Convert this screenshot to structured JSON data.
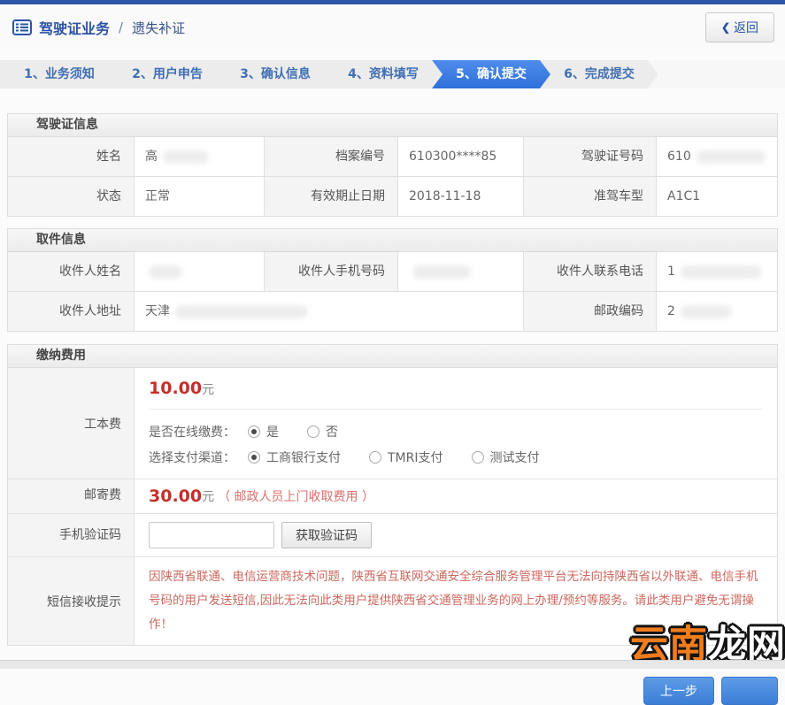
{
  "header": {
    "title": "驾驶证业务",
    "separator": "/",
    "subtitle": "遗失补证",
    "back_chevron": "❮",
    "back_label": "返回"
  },
  "steps": [
    {
      "label": "1、业务须知",
      "active": false
    },
    {
      "label": "2、用户申告",
      "active": false
    },
    {
      "label": "3、确认信息",
      "active": false
    },
    {
      "label": "4、资料填写",
      "active": false
    },
    {
      "label": "5、确认提交",
      "active": true
    },
    {
      "label": "6、完成提交",
      "active": false
    }
  ],
  "license_info": {
    "section_title": "驾驶证信息",
    "name_label": "姓名",
    "name_value": "高",
    "file_no_label": "档案编号",
    "file_no_value": "610300****85",
    "license_no_label": "驾驶证号码",
    "license_no_value": "610",
    "status_label": "状态",
    "status_value": "正常",
    "expiry_label": "有效期止日期",
    "expiry_value": "2018-11-18",
    "vehicle_class_label": "准驾车型",
    "vehicle_class_value": "A1C1"
  },
  "pickup_info": {
    "section_title": "取件信息",
    "recipient_name_label": "收件人姓名",
    "recipient_name_value": "",
    "recipient_mobile_label": "收件人手机号码",
    "recipient_mobile_value": "",
    "recipient_phone_label": "收件人联系电话",
    "recipient_phone_value": "1",
    "recipient_address_label": "收件人地址",
    "recipient_address_value": "天津",
    "postcode_label": "邮政编码",
    "postcode_value": "2"
  },
  "payment": {
    "section_title": "缴纳费用",
    "cost_label": "工本费",
    "cost_amount": "10.00",
    "cost_unit": "元",
    "online_pay_label": "是否在线缴费：",
    "online_pay_options": [
      {
        "label": "是",
        "selected": true
      },
      {
        "label": "否",
        "selected": false
      }
    ],
    "channel_label": "选择支付渠道：",
    "channel_options": [
      {
        "label": "工商银行支付",
        "selected": true
      },
      {
        "label": "TMRI支付",
        "selected": false
      },
      {
        "label": "测试支付",
        "selected": false
      }
    ],
    "postage_label": "邮寄费",
    "postage_amount": "30.00",
    "postage_unit": "元",
    "postage_note": "（ 邮政人员上门收取费用 ）",
    "sms_code_label": "手机验证码",
    "sms_code_value": "",
    "get_code_button": "获取验证码",
    "sms_tip_label": "短信接收提示",
    "sms_tip_text": "因陕西省联通、电信运营商技术问题，陕西省互联网交通安全综合服务管理平台无法向持陕西省以外联通、电信手机号码的用户发送短信,因此无法向此类用户提供陕西省交通管理业务的网上办理/预约等服务。请此类用户避免无谓操作！"
  },
  "footer": {
    "prev_button": "上一步"
  },
  "watermark": {
    "part1": "云南",
    "part2": "龙网"
  },
  "colors": {
    "brand_navy": "#2b55a7",
    "active_step_blue": "#3a7ce2",
    "money_red": "#c52f2b",
    "tip_red": "#cb685e",
    "button_blue": "#3c7ed6"
  }
}
